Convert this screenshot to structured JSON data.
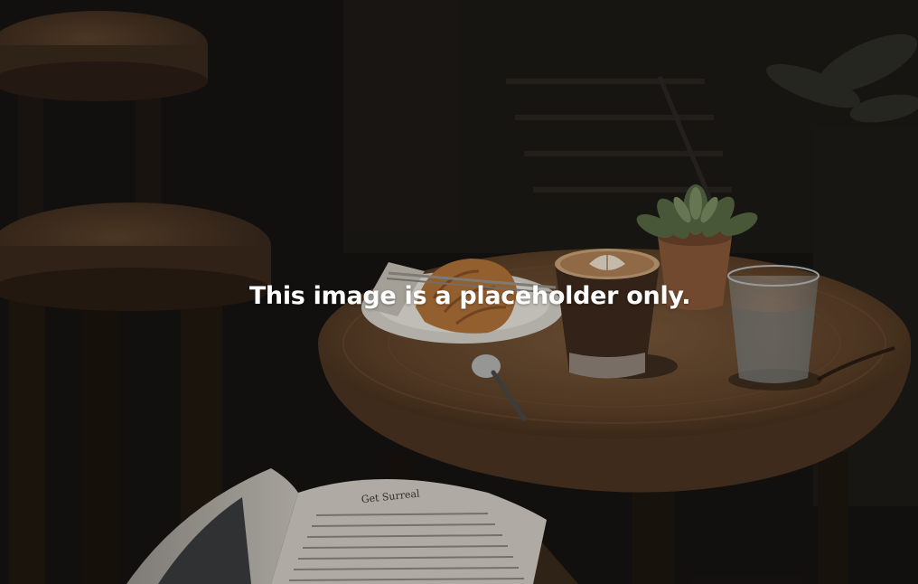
{
  "placeholder": {
    "message": "This image is a placeholder only."
  },
  "magazine": {
    "headline": "Get Surreal"
  },
  "colors": {
    "background": "#141210",
    "wood": "#7a5a3c",
    "caption": "#ffffff"
  }
}
